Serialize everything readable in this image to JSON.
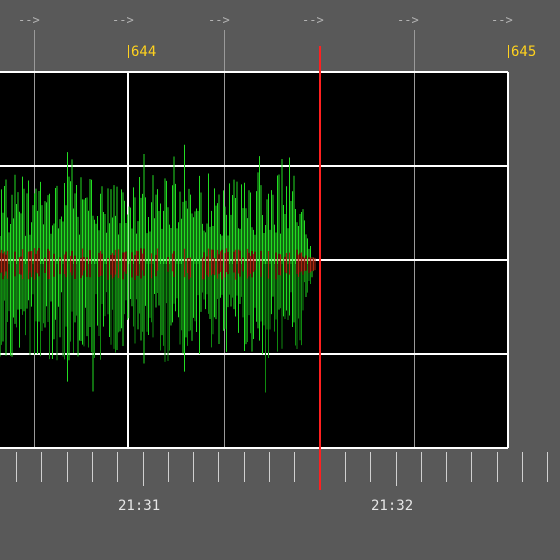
{
  "colors": {
    "chrome_background": "#595959",
    "track_background": "#000000",
    "grid": "#ffffff",
    "playhead": "#ff2020",
    "waveform_bright": "#22dd22",
    "waveform_dark": "#0f8a0f",
    "waveform_accent": "#aa2a10",
    "beat_label": "#ffd21e",
    "time_label": "#e6e6e6",
    "marker_label": "#b4b4b4"
  },
  "markers": [
    "-->",
    "-->",
    "-->",
    "-->",
    "-->",
    "-->"
  ],
  "beat_labels": [
    "644",
    "645"
  ],
  "time_labels": [
    "21:31",
    "21:32"
  ]
}
